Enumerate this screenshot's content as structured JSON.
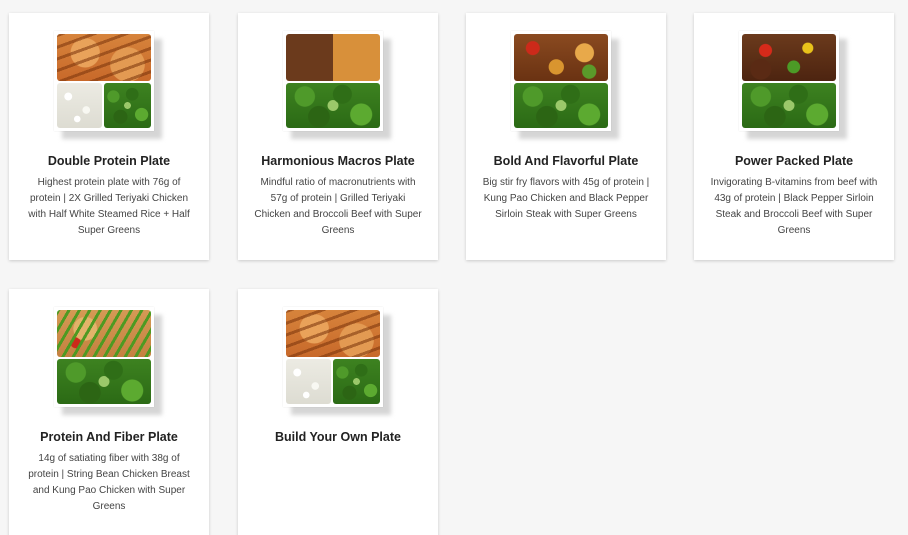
{
  "plates": [
    {
      "title": "Double Protein Plate",
      "description": "Highest protein plate with 76g of protein | 2X Grilled Teriyaki Chicken with Half White Steamed Rice + Half Super Greens",
      "layout": "half-two-quarters",
      "foods": [
        "chicken",
        "rice",
        "greens"
      ]
    },
    {
      "title": "Harmonious Macros Plate",
      "description": "Mindful ratio of macronutrients with 57g of protein | Grilled Teriyaki Chicken and Broccoli Beef with Super Greens",
      "layout": "half-half",
      "foods": [
        "mixed",
        "greens"
      ]
    },
    {
      "title": "Bold And Flavorful Plate",
      "description": "Big stir fry flavors with 45g of protein | Kung Pao Chicken and Black Pepper Sirloin Steak with Super Greens",
      "layout": "half-half",
      "foods": [
        "kungpao",
        "greens"
      ]
    },
    {
      "title": "Power Packed Plate",
      "description": "Invigorating B-vitamins from beef with 43g of protein | Black Pepper Sirloin Steak and Broccoli Beef with Super Greens",
      "layout": "half-half",
      "foods": [
        "beef",
        "greens"
      ]
    },
    {
      "title": "Protein And Fiber Plate",
      "description": "14g of satiating fiber with 38g of protein | String Bean Chicken Breast and Kung Pao Chicken with Super Greens",
      "layout": "half-half",
      "foods": [
        "stringbean",
        "greens"
      ]
    },
    {
      "title": "Build Your Own Plate",
      "description": "",
      "layout": "half-two-quarters",
      "foods": [
        "chicken",
        "rice",
        "greens"
      ]
    }
  ]
}
